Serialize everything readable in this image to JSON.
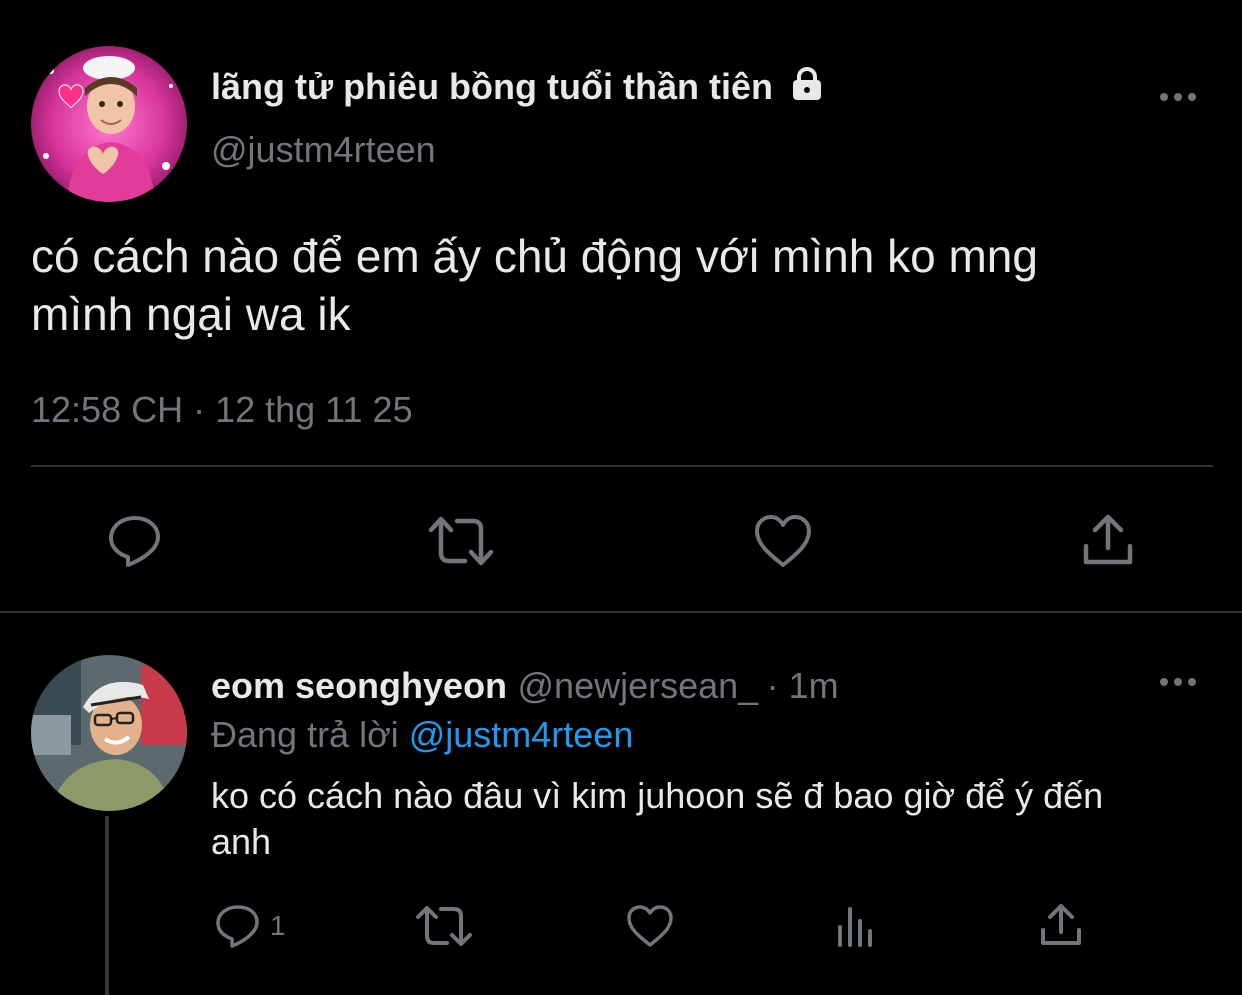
{
  "main_tweet": {
    "display_name": "lãng tử phiêu bồng tuổi thần tiên",
    "locked_icon": "lock-icon",
    "handle": "@justm4rteen",
    "text_line1": "có cách nào để em ấy chủ động với mình ko mng",
    "text_line2": "mình ngại wa ik",
    "timestamp": "12:58 CH · 12 thg 11 25",
    "actions": [
      "reply-icon",
      "retweet-icon",
      "like-icon",
      "share-icon"
    ]
  },
  "reply": {
    "display_name": "eom seonghyeon",
    "handle": "@newjersean_",
    "time": "· 1m",
    "replying_prefix": "Đang trả lời",
    "replying_to": "@justm4rteen",
    "text_line1": "ko có cách nào đâu vì kim juhoon sẽ đ bao giờ để ý đến",
    "text_line2": "anh",
    "reply_count": "1",
    "actions": [
      "reply-icon",
      "retweet-icon",
      "like-icon",
      "views-icon",
      "share-icon"
    ]
  },
  "colors": {
    "background": "#000000",
    "text": "#e7e9ea",
    "secondary": "#71767b",
    "accent": "#1d9bf0",
    "divider": "#2f3336"
  }
}
